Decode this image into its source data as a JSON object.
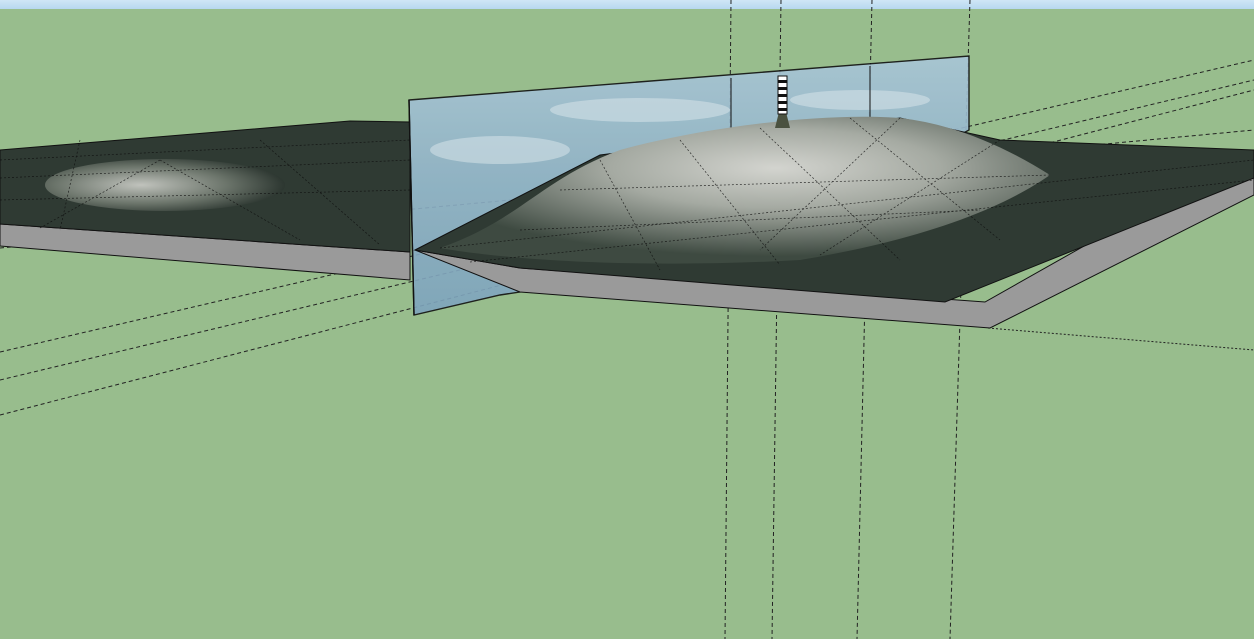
{
  "scene": {
    "colors": {
      "ground": "#98bd8d",
      "sky": "#cfe6f6",
      "slab_side": "#9a9a9a",
      "terrain_dark": "#2f3a33",
      "terrain_light": "#c9cbc6",
      "glass": "#8fb3c9",
      "edge": "#111111"
    },
    "objects": [
      "sketchup-3d-viewport",
      "left-terrain-slab",
      "right-terrain-slab",
      "glass-section-plane",
      "striped-tower",
      "construction-guidelines"
    ]
  }
}
